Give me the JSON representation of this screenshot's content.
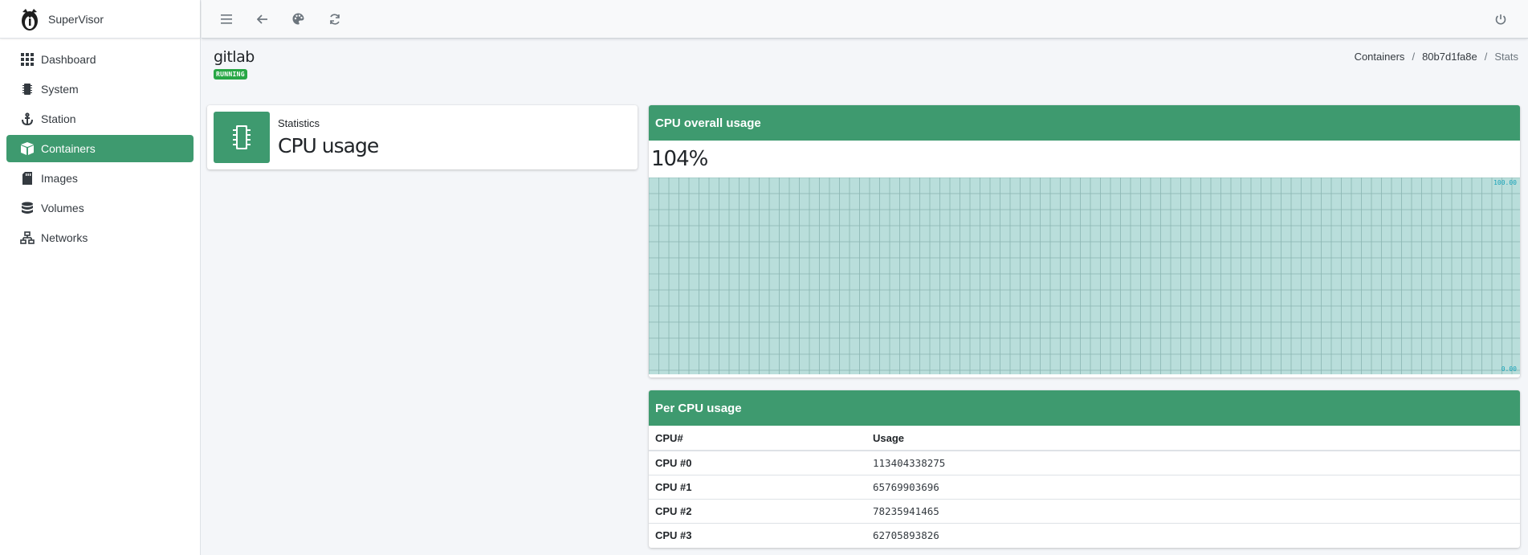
{
  "app": {
    "brand": "SuperVisor"
  },
  "sidebar": {
    "items": [
      {
        "label": "Dashboard",
        "icon": "grid-icon",
        "active": false
      },
      {
        "label": "System",
        "icon": "chip-icon",
        "active": false
      },
      {
        "label": "Station",
        "icon": "anchor-icon",
        "active": false
      },
      {
        "label": "Containers",
        "icon": "boxes-icon",
        "active": true
      },
      {
        "label": "Images",
        "icon": "sd-card-icon",
        "active": false
      },
      {
        "label": "Volumes",
        "icon": "database-icon",
        "active": false
      },
      {
        "label": "Networks",
        "icon": "network-icon",
        "active": false
      }
    ]
  },
  "topbar": {
    "buttons": [
      "menu-icon",
      "back-arrow-icon",
      "palette-icon",
      "refresh-icon"
    ],
    "right_button": "power-icon"
  },
  "header": {
    "title": "gitlab",
    "status": "RUNNING",
    "breadcrumb": [
      "Containers",
      "80b7d1fa8e",
      "Stats"
    ]
  },
  "info_box": {
    "text": "Statistics",
    "number": "CPU usage",
    "icon": "chip-icon"
  },
  "cpu_card": {
    "title": "CPU overall usage",
    "value": "104%",
    "axis_max_label": "100.00",
    "axis_min_label": "0.00"
  },
  "per_cpu_card": {
    "title": "Per CPU usage",
    "columns": [
      "CPU#",
      "Usage"
    ],
    "rows": [
      {
        "cpu": "CPU #0",
        "usage": "113404338275"
      },
      {
        "cpu": "CPU #1",
        "usage": "65769903696"
      },
      {
        "cpu": "CPU #2",
        "usage": "78235941465"
      },
      {
        "cpu": "CPU #3",
        "usage": "62705893826"
      }
    ]
  },
  "colors": {
    "accent": "#3e9a6f",
    "badge": "#28a745",
    "chart_fill": "#b9dedb",
    "chart_grid": "#8ab5b1",
    "chart_label": "#17a2b8"
  }
}
